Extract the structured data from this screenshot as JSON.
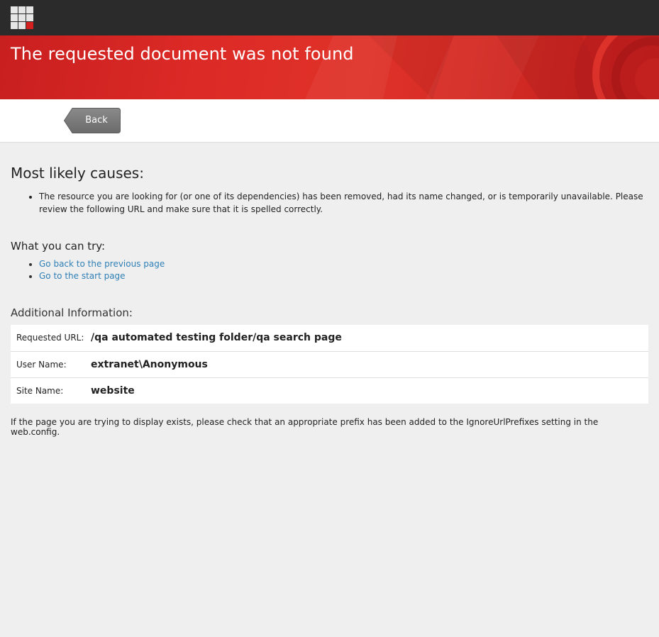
{
  "header": {
    "logo_icon": "app-grid-icon"
  },
  "banner": {
    "title": "The requested document was not found",
    "color": "#dc2a26"
  },
  "toolbar": {
    "back_label": "Back"
  },
  "causes": {
    "heading": "Most likely causes:",
    "items": [
      "The resource you are looking for (or one of its dependencies) has been removed, had its name changed, or is temporarily unavailable. Please review the following URL and make sure that it is spelled correctly."
    ]
  },
  "try": {
    "heading": "What you can try:",
    "links": [
      "Go back to the previous page",
      "Go to the start page"
    ],
    "link_color": "#2f7fb6"
  },
  "info": {
    "heading": "Additional Information:",
    "rows": [
      {
        "label": "Requested URL:",
        "value": "/qa automated testing folder/qa search page"
      },
      {
        "label": "User Name:",
        "value": "extranet\\Anonymous"
      },
      {
        "label": "Site Name:",
        "value": "website"
      }
    ]
  },
  "note": "If the page you are trying to display exists, please check that an appropriate prefix has been added to the IgnoreUrlPrefixes setting in the web.config."
}
